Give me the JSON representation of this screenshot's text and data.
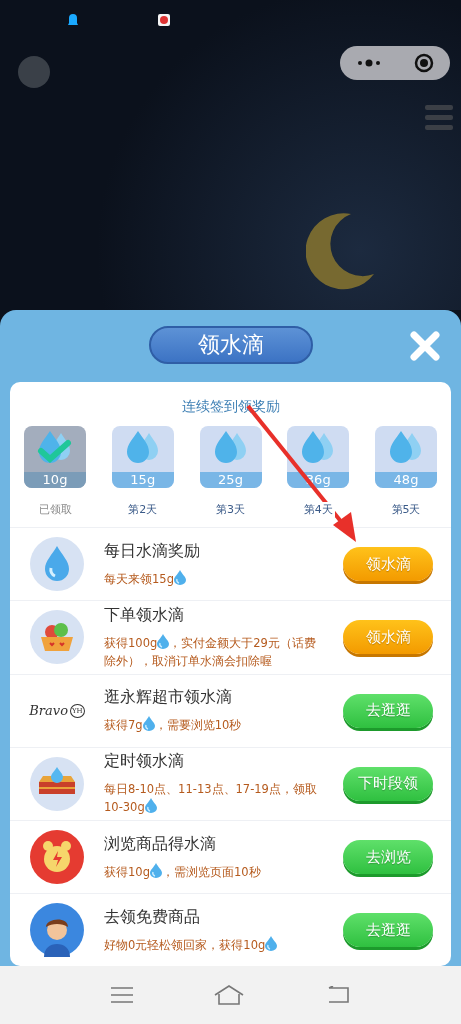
{
  "panel": {
    "title": "领水滴"
  },
  "checkin": {
    "heading": "连续签到领奖励",
    "days": [
      {
        "amount": "10g",
        "label": "已领取",
        "claimed": true
      },
      {
        "amount": "15g",
        "label": "第2天",
        "claimed": false
      },
      {
        "amount": "25g",
        "label": "第3天",
        "claimed": false
      },
      {
        "amount": "36g",
        "label": "第4天",
        "claimed": false
      },
      {
        "amount": "48g",
        "label": "第5天",
        "claimed": false
      }
    ]
  },
  "tasks": [
    {
      "kind": "drop",
      "title": "每日水滴奖励",
      "desc": [
        {
          "kind": "text",
          "text": "每天来领15g"
        },
        {
          "kind": "drop"
        }
      ],
      "button": {
        "label": "领水滴",
        "kind": "orange"
      }
    },
    {
      "kind": "basket",
      "title": "下单领水滴",
      "desc": [
        {
          "kind": "text",
          "text": "获得100g"
        },
        {
          "kind": "drop"
        },
        {
          "kind": "text",
          "text": "，实付金额大于29元（话费"
        },
        {
          "kind": "break"
        },
        {
          "kind": "text",
          "text": "除外），取消订单水滴会扣除喔"
        }
      ],
      "button": {
        "label": "领水滴",
        "kind": "orange"
      }
    },
    {
      "kind": "logo",
      "logo_text": "Bravo",
      "logo_badge": "YH",
      "title": "逛永辉超市领水滴",
      "desc": [
        {
          "kind": "text",
          "text": "获得7g"
        },
        {
          "kind": "drop"
        },
        {
          "kind": "text",
          "text": "，需要浏览10秒"
        }
      ],
      "button": {
        "label": "去逛逛",
        "kind": "green"
      }
    },
    {
      "kind": "chest",
      "title": "定时领水滴",
      "desc": [
        {
          "kind": "text",
          "text": "每日8-10点、11-13点、17-19点，领取"
        },
        {
          "kind": "break"
        },
        {
          "kind": "text",
          "text": "10-30g"
        },
        {
          "kind": "drop"
        }
      ],
      "button": {
        "label": "下时段领",
        "kind": "green"
      }
    },
    {
      "kind": "clock",
      "title": "浏览商品得水滴",
      "desc": [
        {
          "kind": "text",
          "text": "获得10g"
        },
        {
          "kind": "drop"
        },
        {
          "kind": "text",
          "text": "，需浏览页面10秒"
        }
      ],
      "button": {
        "label": "去浏览",
        "kind": "green"
      }
    },
    {
      "kind": "person",
      "title": "去领免费商品",
      "desc": [
        {
          "kind": "text",
          "text": "好物0元轻松领回家，获得10g"
        },
        {
          "kind": "drop"
        }
      ],
      "button": {
        "label": "去逛逛",
        "kind": "green"
      }
    }
  ]
}
